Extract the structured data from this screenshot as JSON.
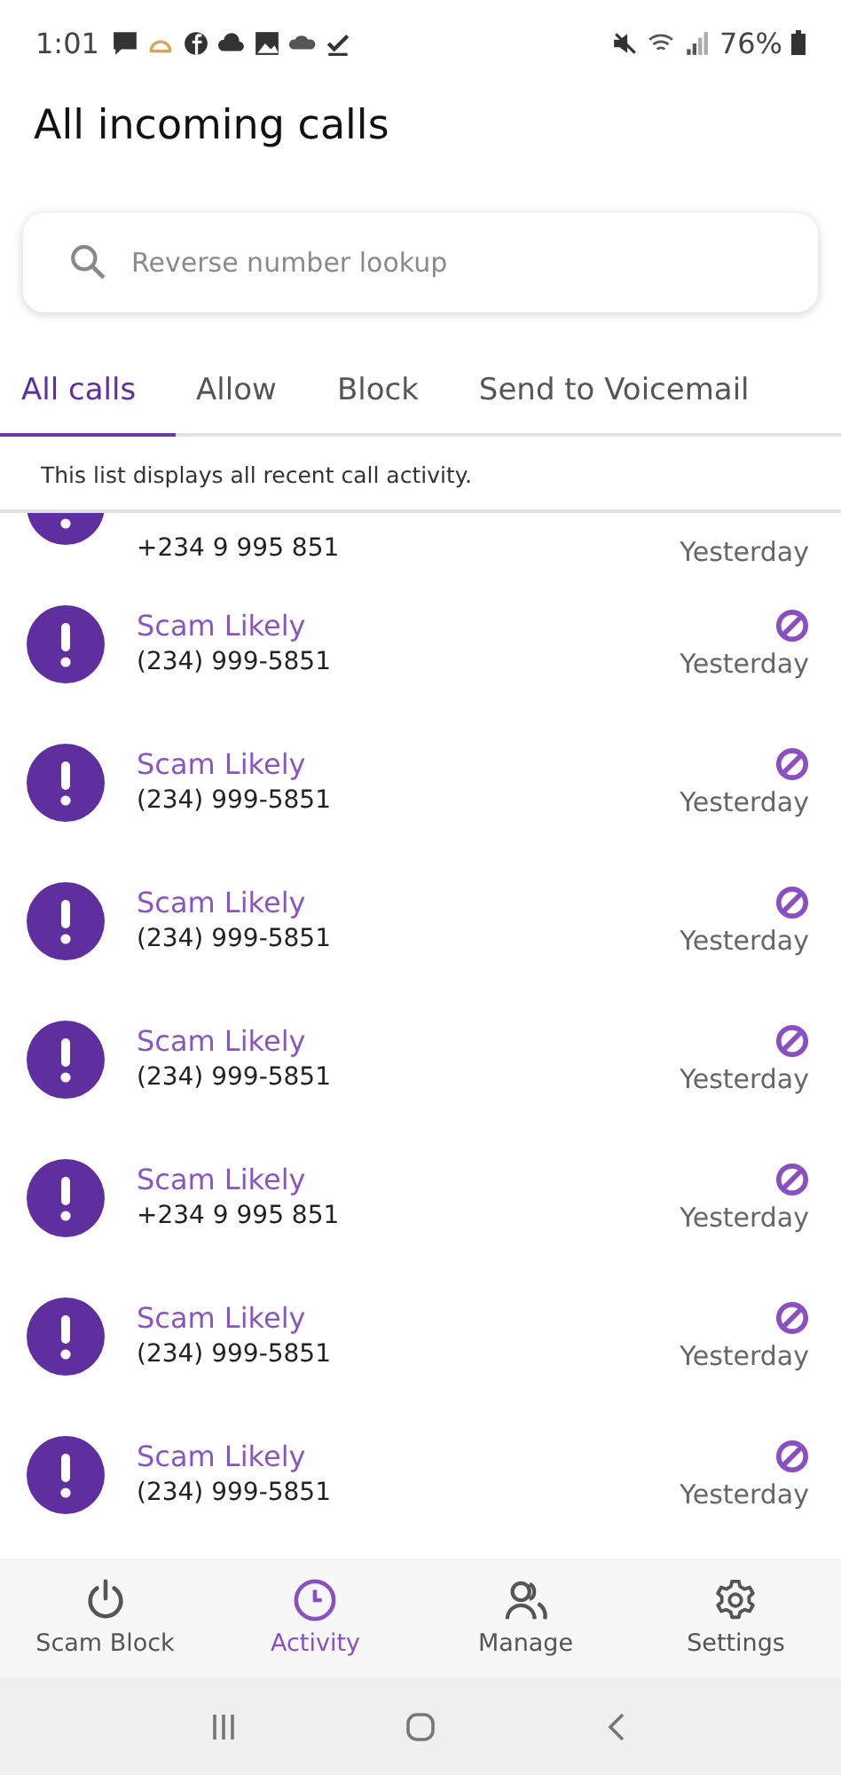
{
  "status_bar": {
    "time": "1:01",
    "battery": "76%"
  },
  "title": "All incoming calls",
  "search": {
    "placeholder": "Reverse number lookup"
  },
  "tabs": [
    {
      "label": "All calls",
      "selected": true
    },
    {
      "label": "Allow",
      "selected": false
    },
    {
      "label": "Block",
      "selected": false
    },
    {
      "label": "Send to Voicemail",
      "selected": false
    }
  ],
  "info": "This list displays all recent call activity.",
  "calls": [
    {
      "kind": "partial",
      "number": "+234 9 995 851",
      "time": "Yesterday"
    },
    {
      "kind": "full",
      "name": "Scam Likely",
      "number": "(234) 999-5851",
      "time": "Yesterday",
      "blocked": true
    },
    {
      "kind": "full",
      "name": "Scam Likely",
      "number": "(234) 999-5851",
      "time": "Yesterday",
      "blocked": true
    },
    {
      "kind": "full",
      "name": "Scam Likely",
      "number": "(234) 999-5851",
      "time": "Yesterday",
      "blocked": true
    },
    {
      "kind": "full",
      "name": "Scam Likely",
      "number": "(234) 999-5851",
      "time": "Yesterday",
      "blocked": true
    },
    {
      "kind": "full",
      "name": "Scam Likely",
      "number": "+234 9 995 851",
      "time": "Yesterday",
      "blocked": true
    },
    {
      "kind": "full",
      "name": "Scam Likely",
      "number": "(234) 999-5851",
      "time": "Yesterday",
      "blocked": true
    },
    {
      "kind": "full",
      "name": "Scam Likely",
      "number": "(234) 999-5851",
      "time": "Yesterday",
      "blocked": true
    }
  ],
  "nav": [
    {
      "kind": "power",
      "label": "Scam Block",
      "selected": false
    },
    {
      "kind": "clock",
      "label": "Activity",
      "selected": true
    },
    {
      "kind": "people",
      "label": "Manage",
      "selected": false
    },
    {
      "kind": "gear",
      "label": "Settings",
      "selected": false
    }
  ]
}
